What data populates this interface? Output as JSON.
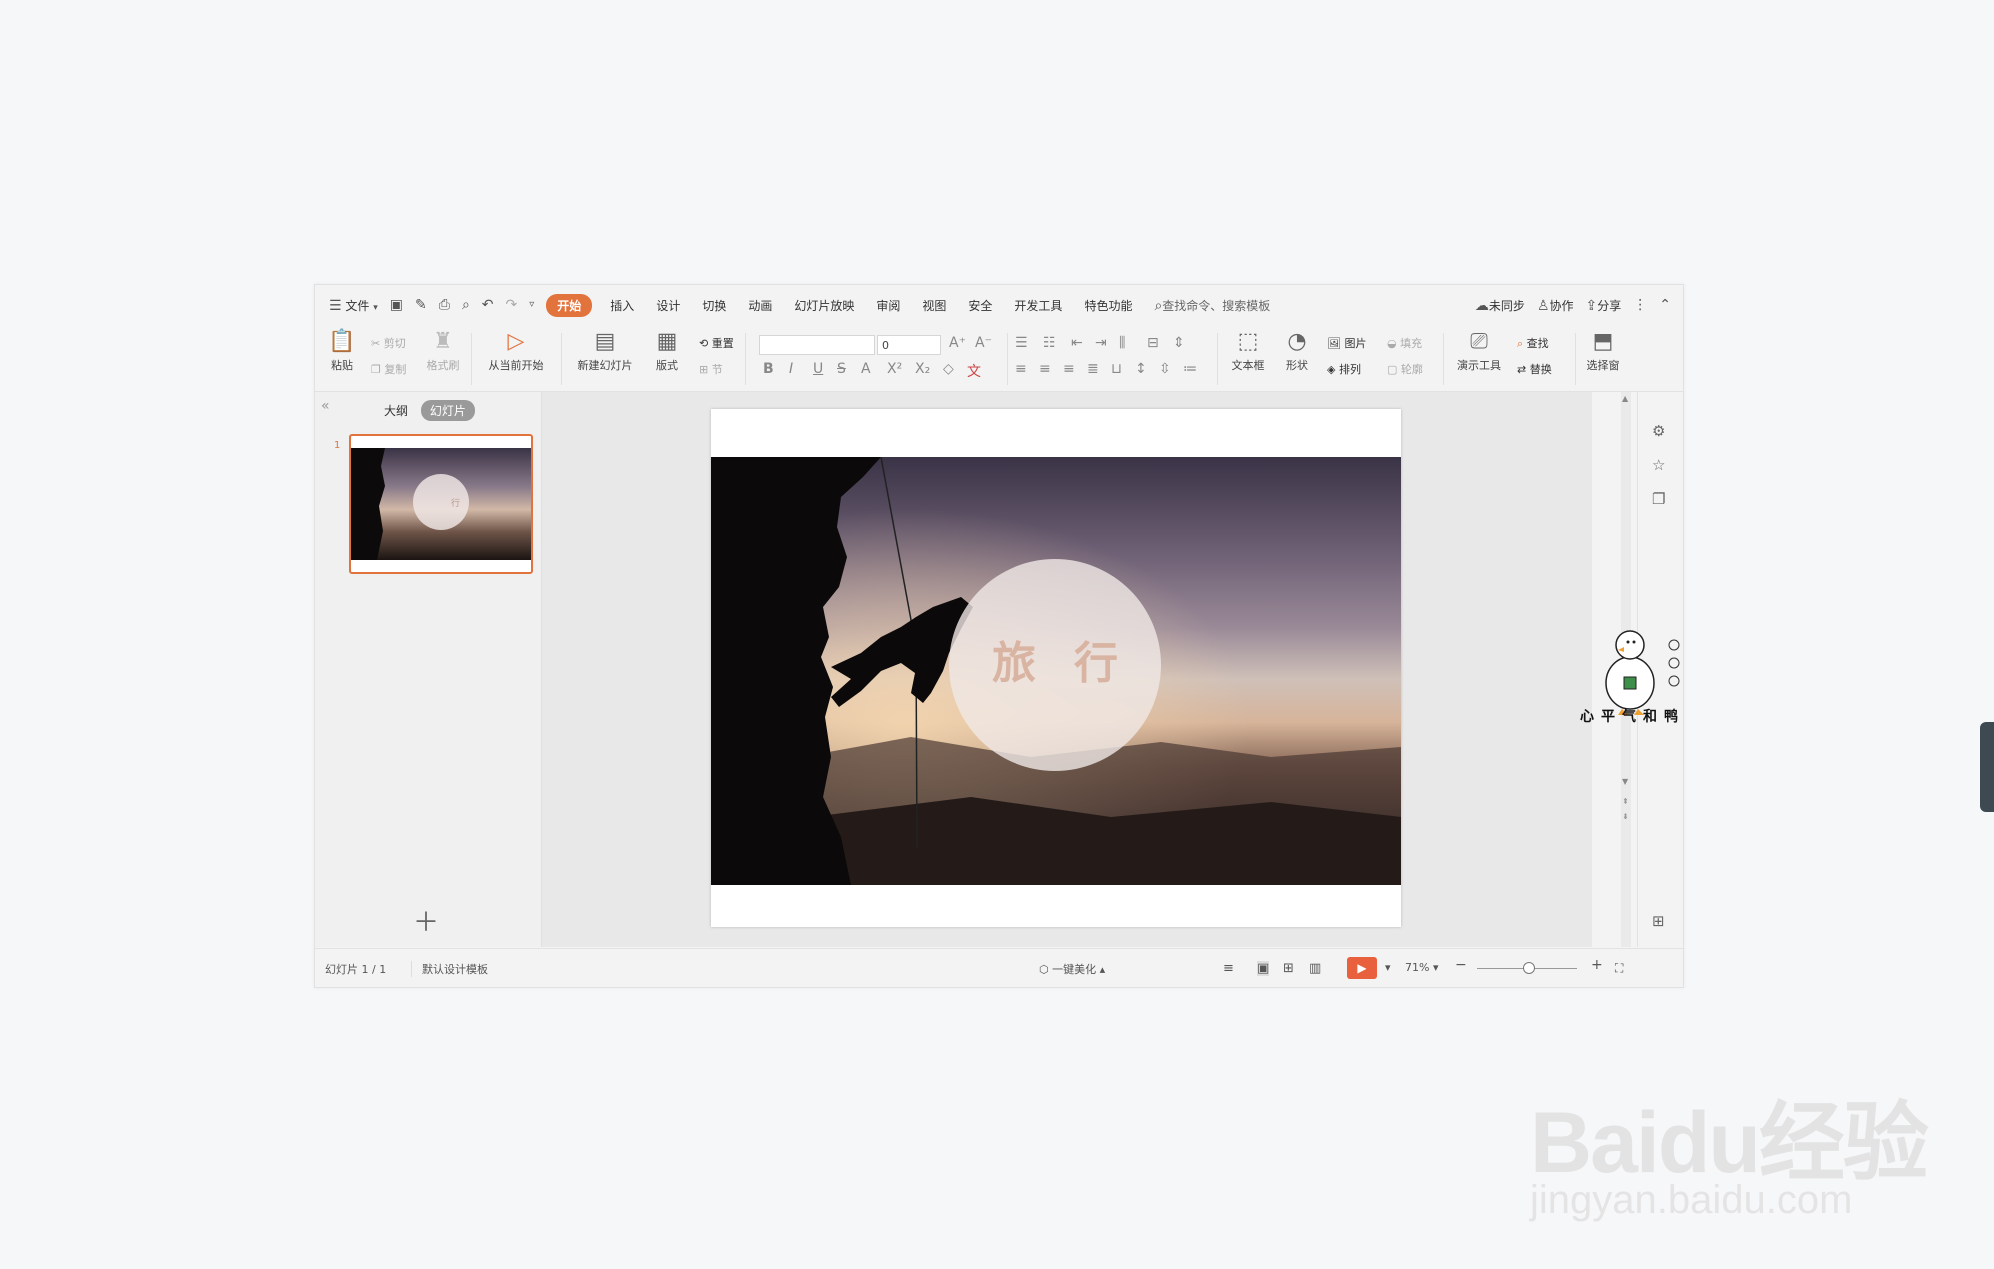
{
  "menu": {
    "file": "文件",
    "tabs": [
      "开始",
      "插入",
      "设计",
      "切换",
      "动画",
      "幻灯片放映",
      "审阅",
      "视图",
      "安全",
      "开发工具",
      "特色功能"
    ],
    "search": "查找命令、搜索模板",
    "right": [
      "未同步",
      "协作",
      "分享"
    ]
  },
  "ribbon": {
    "paste": "粘贴",
    "cut": "剪切",
    "copy": "复制",
    "format_painter": "格式刷",
    "play_from_current": "从当前开始",
    "new_slide": "新建幻灯片",
    "layout": "版式",
    "reset": "重置",
    "section": "节",
    "font_size": "0",
    "textbox": "文本框",
    "shape": "形状",
    "picture": "图片",
    "arrange": "排列",
    "fill": "填充",
    "outline": "轮廓",
    "present_tools": "演示工具",
    "find": "查找",
    "replace": "替换",
    "select_pane": "选择窗"
  },
  "panel": {
    "tab_outline": "大纲",
    "tab_slides": "幻灯片",
    "slide_number": "1"
  },
  "slide": {
    "title": "旅行"
  },
  "status": {
    "slide_count": "幻灯片 1 / 1",
    "template": "默认设计模板",
    "beautify": "一键美化",
    "zoom": "71%"
  },
  "mascot": {
    "caption": "心平气和鸭"
  },
  "watermark": {
    "logo": "Baidu经验",
    "url": "jingyan.baidu.com"
  }
}
